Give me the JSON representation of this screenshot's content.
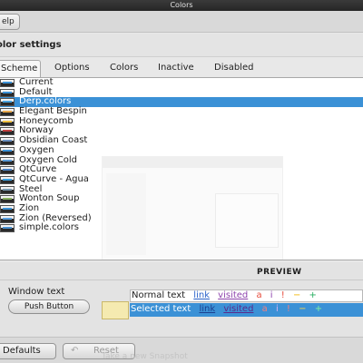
{
  "window": {
    "title": "Colors"
  },
  "toolbar": {
    "help_label": "elp"
  },
  "header": {
    "title": "olor settings"
  },
  "tabs": [
    {
      "label": "Scheme",
      "active": true
    },
    {
      "label": "Options",
      "active": false
    },
    {
      "label": "Colors",
      "active": false
    },
    {
      "label": "Inactive",
      "active": false
    },
    {
      "label": "Disabled",
      "active": false
    }
  ],
  "schemes": [
    {
      "label": "Current",
      "swatch_color": "#3b91d6"
    },
    {
      "label": "Default",
      "swatch_color": "#3b91d6"
    },
    {
      "label": "Derp.colors",
      "swatch_color": "#4aa3df",
      "selected": true
    },
    {
      "label": "Elegant Bespin",
      "swatch_color": "#e8a84c"
    },
    {
      "label": "Honeycomb",
      "swatch_color": "#f0c040"
    },
    {
      "label": "Norway",
      "swatch_color": "#c04040"
    },
    {
      "label": "Obsidian Coast",
      "swatch_color": "#6a8fbf"
    },
    {
      "label": "Oxygen",
      "swatch_color": "#3b91d6"
    },
    {
      "label": "Oxygen Cold",
      "swatch_color": "#5a9ad6"
    },
    {
      "label": "QtCurve",
      "swatch_color": "#4a80c0"
    },
    {
      "label": "QtCurve - Agua",
      "swatch_color": "#3aa0e0"
    },
    {
      "label": "Steel",
      "swatch_color": "#7a9ab0"
    },
    {
      "label": "Wonton Soup",
      "swatch_color": "#8ab060"
    },
    {
      "label": "Zion",
      "swatch_color": "#3b91d6"
    },
    {
      "label": "Zion (Reversed)",
      "swatch_color": "#5aa0e0"
    },
    {
      "label": "simple.colors",
      "swatch_color": "#4a90d0"
    }
  ],
  "preview": {
    "title": "PREVIEW",
    "window_text": "Window text",
    "push_button": "Push Button",
    "normal": {
      "text": "Normal text",
      "link": "link",
      "visited": "visited",
      "a": "a",
      "i": "i",
      "bang": "!",
      "minus": "−",
      "plus": "+"
    },
    "selected": {
      "text": "Selected text",
      "link": "link",
      "visited": "visited",
      "a": "a",
      "i": "i",
      "bang": "!",
      "minus": "−",
      "plus": "+"
    }
  },
  "bottom": {
    "defaults_label": "Defaults",
    "reset_label": "Reset",
    "ghost_text": "Take a new Snapshot"
  },
  "colors": {
    "selection": "#3b91d6",
    "link": "#2a62c9",
    "visited": "#8e44ad",
    "negative": "#e74c3c",
    "neutral": "#f0b400",
    "positive": "#27ae60"
  }
}
